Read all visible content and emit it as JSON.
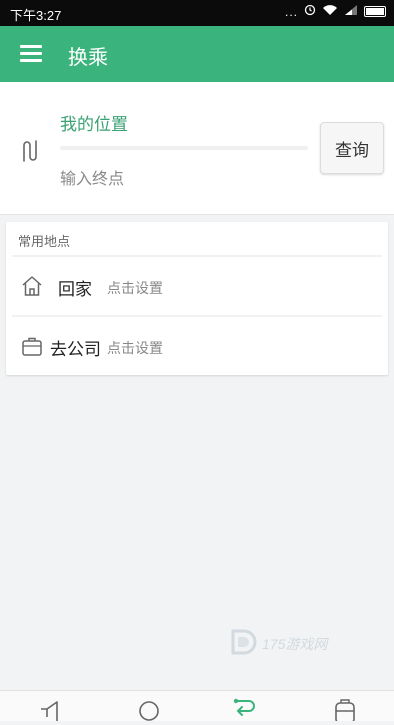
{
  "status_bar": {
    "time": "下午3:27",
    "signal_dots": "...",
    "icons": [
      "alarm-icon",
      "wifi-icon",
      "signal-icon",
      "battery-icon"
    ]
  },
  "toolbar": {
    "title": "换乘",
    "menu_icon": "hamburger-menu-icon",
    "background_color": "#3bb37c"
  },
  "route": {
    "start": "我的位置",
    "destination_value": "",
    "destination_placeholder": "输入终点",
    "query_button": "查询",
    "swap_icon": "swap-route-icon"
  },
  "frequent_places": {
    "title": "常用地点",
    "items": [
      {
        "name": "回家",
        "hint": "点击设置",
        "icon": "home-icon"
      },
      {
        "name": "去公司",
        "hint": "点击设置",
        "icon": "briefcase-icon"
      }
    ]
  },
  "watermark": {
    "text": "175游戏网"
  },
  "bottom_nav": {
    "items": [
      {
        "icon": "megaphone-icon"
      },
      {
        "icon": "circle-icon"
      },
      {
        "icon": "transfer-icon",
        "active": true
      },
      {
        "icon": "bus-icon"
      }
    ]
  }
}
